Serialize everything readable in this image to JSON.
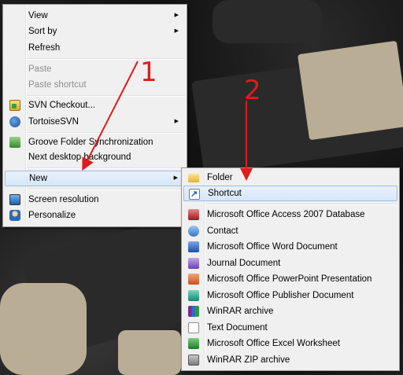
{
  "context_menu": {
    "items": [
      {
        "label": "View"
      },
      {
        "label": "Sort by"
      },
      {
        "label": "Refresh"
      },
      {
        "label": "Paste"
      },
      {
        "label": "Paste shortcut"
      },
      {
        "label": "SVN Checkout..."
      },
      {
        "label": "TortoiseSVN"
      },
      {
        "label": "Groove Folder Synchronization"
      },
      {
        "label": "Next desktop background"
      },
      {
        "label": "New"
      },
      {
        "label": "Screen resolution"
      },
      {
        "label": "Personalize"
      }
    ]
  },
  "new_submenu": {
    "items": [
      {
        "label": "Folder"
      },
      {
        "label": "Shortcut"
      },
      {
        "label": "Microsoft Office Access 2007 Database"
      },
      {
        "label": "Contact"
      },
      {
        "label": "Microsoft Office Word Document"
      },
      {
        "label": "Journal Document"
      },
      {
        "label": "Microsoft Office PowerPoint Presentation"
      },
      {
        "label": "Microsoft Office Publisher Document"
      },
      {
        "label": "WinRAR archive"
      },
      {
        "label": "Text Document"
      },
      {
        "label": "Microsoft Office Excel Worksheet"
      },
      {
        "label": "WinRAR ZIP archive"
      }
    ]
  },
  "annotations": {
    "step1": "1",
    "step2": "2",
    "arrow_color": "#e01b1b"
  }
}
